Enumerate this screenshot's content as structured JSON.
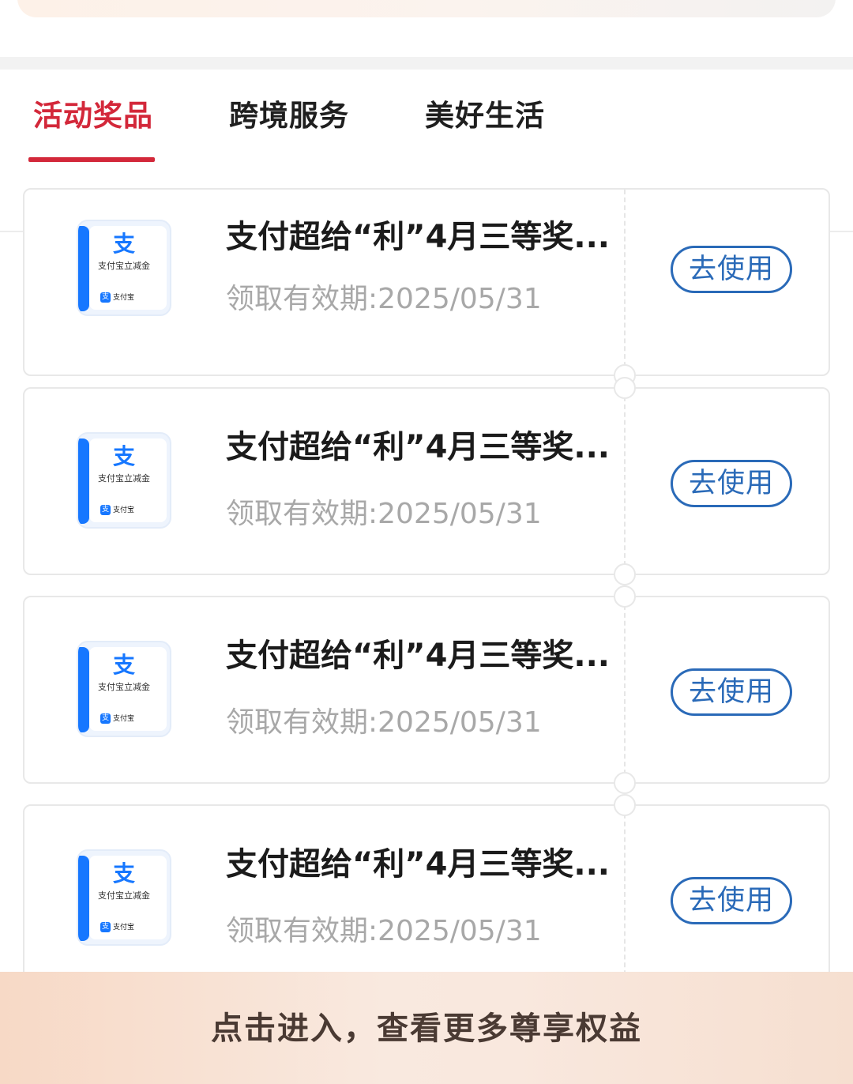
{
  "tabs": [
    {
      "label": "活动奖品",
      "active": true
    },
    {
      "label": "跨境服务",
      "active": false
    },
    {
      "label": "美好生活",
      "active": false
    }
  ],
  "thumb": {
    "glyph": "支",
    "title": "支付宝立减金",
    "brand": "支付宝"
  },
  "coupons": [
    {
      "name": "支付超给“利”4月三等奖...",
      "validity": "领取有效期:2025/05/31",
      "action": "去使用"
    },
    {
      "name": "支付超给“利”4月三等奖...",
      "validity": "领取有效期:2025/05/31",
      "action": "去使用"
    },
    {
      "name": "支付超给“利”4月三等奖...",
      "validity": "领取有效期:2025/05/31",
      "action": "去使用"
    },
    {
      "name": "支付超给“利”4月三等奖...",
      "validity": "领取有效期:2025/05/31",
      "action": "去使用"
    }
  ],
  "bottom_bar": {
    "label": "点击进入，查看更多尊享权益"
  },
  "colors": {
    "accent": "#d3283a",
    "button": "#2a6ab8",
    "alipay_blue": "#1677ff"
  }
}
